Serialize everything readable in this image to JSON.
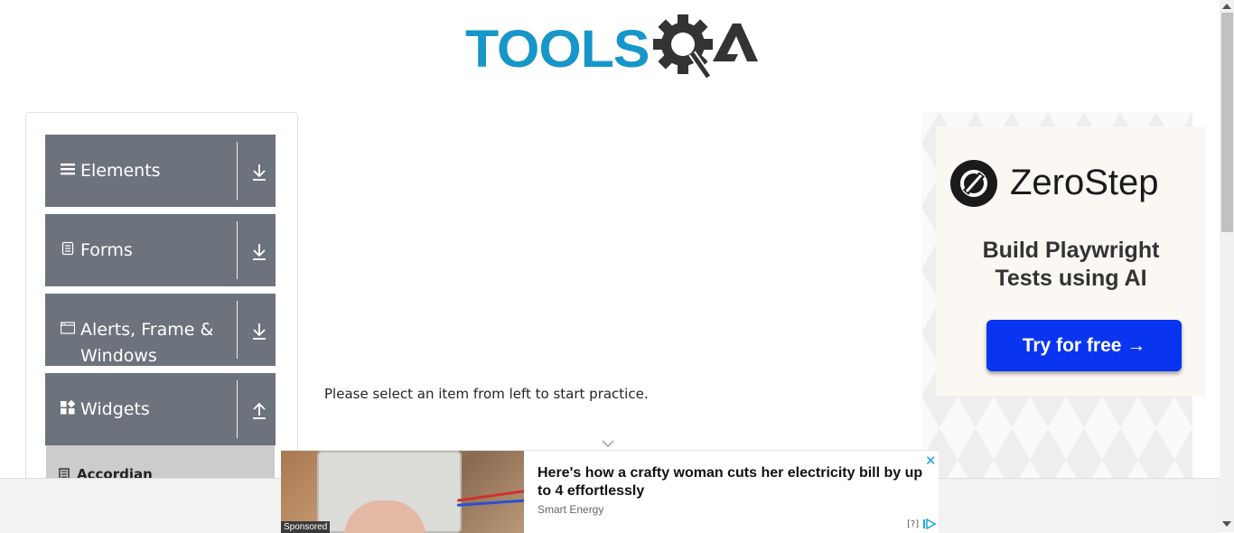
{
  "brand": {
    "logo_text": "TOOLS"
  },
  "sidebar": {
    "groups": [
      {
        "label": "Elements",
        "icon": "hamburger-icon",
        "arrow": "download-arrow-icon"
      },
      {
        "label": "Forms",
        "icon": "document-icon",
        "arrow": "download-arrow-icon"
      },
      {
        "label": "Alerts, Frame & Windows",
        "icon": "window-icon",
        "arrow": "download-arrow-icon"
      },
      {
        "label": "Widgets",
        "icon": "widgets-icon",
        "arrow": "upload-arrow-icon"
      }
    ],
    "sub_item": {
      "label": "Accordian",
      "icon": "accordian-icon"
    }
  },
  "main": {
    "message": "Please select an item from left to start practice."
  },
  "right_ad": {
    "brand": "ZeroStep",
    "tagline_line1": "Build Playwright",
    "tagline_line2": "Tests using AI",
    "cta": "Try for free →",
    "brand_color": "#0a35f0"
  },
  "bottom_ad": {
    "title": "Here's how a crafty woman cuts her electricity bill by up to 4 effortlessly",
    "source": "Smart Energy",
    "sponsored": "Sponsored",
    "help": "[?]",
    "close": "✕"
  },
  "colors": {
    "logo_blue": "#1796c9",
    "logo_dark": "#333333",
    "group_bg": "#6c737c",
    "sub_bg": "#cccccc"
  }
}
